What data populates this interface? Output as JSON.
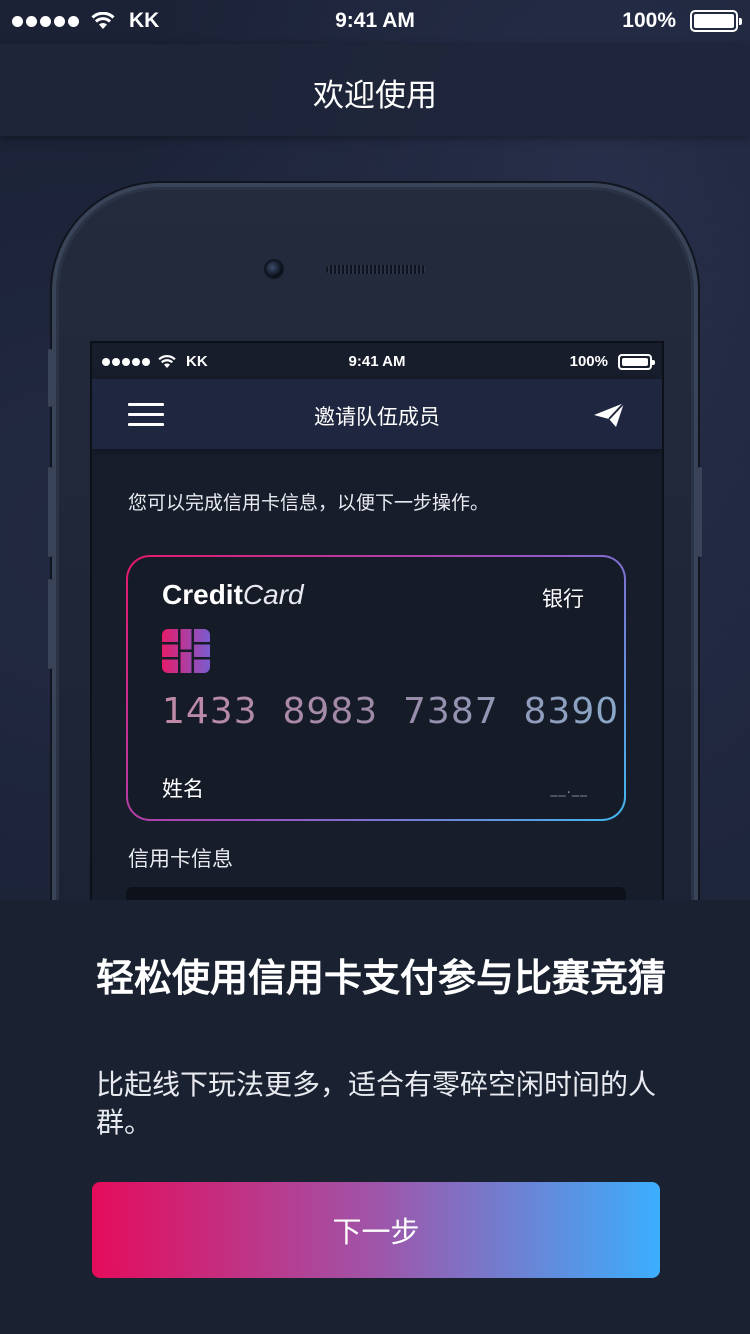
{
  "status_bar": {
    "carrier": "KK",
    "time": "9:41 AM",
    "battery": "100%"
  },
  "header": {
    "title": "欢迎使用"
  },
  "mockup": {
    "status_bar": {
      "carrier": "KK",
      "time": "9:41 AM",
      "battery": "100%"
    },
    "nav": {
      "title": "邀请队伍成员"
    },
    "intro": "您可以完成信用卡信息，以便下一步操作。",
    "card": {
      "brand_bold": "Credit",
      "brand_light": "Card",
      "bank": "银行",
      "number": "1433  8983  7387  8390",
      "name_label": "姓名",
      "expiry": "__.__"
    },
    "section_label": "信用卡信息"
  },
  "onboarding": {
    "headline": "轻松使用信用卡支付参与比赛竞猜",
    "subtext": "比起线下玩法更多，适合有零碎空闲时间的人群。",
    "next_label": "下一步"
  },
  "colors": {
    "gradient_start": "#e50c5c",
    "gradient_end": "#3caefd",
    "background": "#1a2131"
  }
}
